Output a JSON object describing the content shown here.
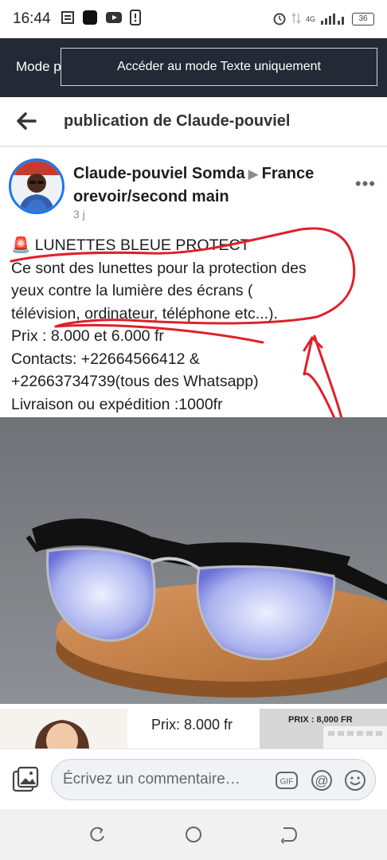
{
  "status_bar": {
    "time": "16:44",
    "network": "4G",
    "battery": "36"
  },
  "top_bar": {
    "mode_label": "Mode p",
    "text_mode_button": "Accéder au mode Texte uniquement"
  },
  "header": {
    "title": "publication de Claude-pouviel"
  },
  "post": {
    "author": "Claude-pouviel Somda",
    "arrow": "▶",
    "group": "France orevoir/second main",
    "time": "3 j",
    "more": "•••",
    "text_lines": [
      "🚨 LUNETTES BLEUE PROTECT",
      "Ce sont des lunettes pour la protection des",
      "yeux contre la lumière des écrans (",
      "télévision, ordinateur, téléphone etc...).",
      "Prix : 8.000 et 6.000 fr",
      "Contacts: +22664566412 &",
      "+22663734739(tous des Whatsapp)",
      "Livraison ou expédition :1000fr"
    ]
  },
  "thumbnails": {
    "price_1": "Prix: 8.000 fr",
    "price_2": "PRIX : 8,000 FR"
  },
  "comment_bar": {
    "placeholder": "Écrivez un commentaire…",
    "gif_label": "GIF",
    "at_label": "@"
  },
  "colors": {
    "top_bar_bg": "#242a35",
    "accent_blue": "#1877f2",
    "annotation_red": "#e0202a"
  }
}
